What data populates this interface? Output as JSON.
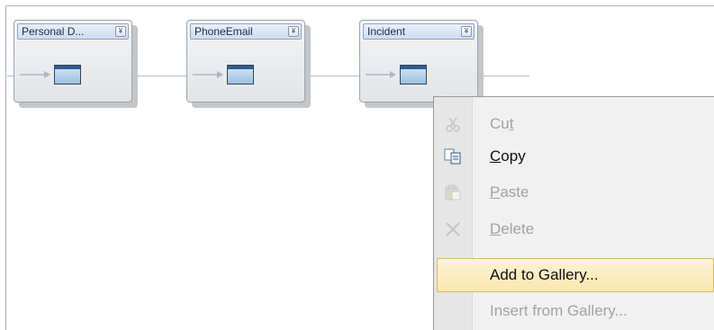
{
  "nodes": [
    {
      "title": "Personal D...",
      "collapse_glyph": "¥"
    },
    {
      "title": "PhoneEmail",
      "collapse_glyph": "¥"
    },
    {
      "title": "Incident",
      "collapse_glyph": "¥"
    }
  ],
  "context_menu": {
    "items": [
      {
        "pre": "Cu",
        "accel": "t",
        "post": "",
        "enabled": false,
        "icon": "cut-icon"
      },
      {
        "pre": "",
        "accel": "C",
        "post": "opy",
        "enabled": true,
        "icon": "copy-icon"
      },
      {
        "pre": "",
        "accel": "P",
        "post": "aste",
        "enabled": false,
        "icon": "paste-icon"
      },
      {
        "pre": "",
        "accel": "D",
        "post": "elete",
        "enabled": false,
        "icon": "delete-icon"
      },
      {
        "label": "Add to Gallery...",
        "enabled": true,
        "highlighted": true
      },
      {
        "label": "Insert from Gallery...",
        "enabled": false
      }
    ]
  },
  "colors": {
    "highlight": "#fbe7ae",
    "disabled_text": "#a3a3a3",
    "title_bar": "#cfdcef"
  }
}
